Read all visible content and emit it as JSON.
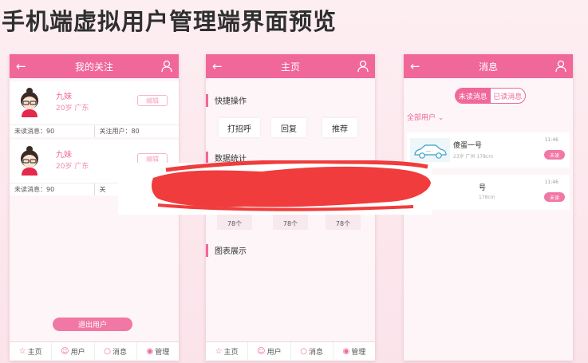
{
  "page": {
    "title": "手机端虚拟用户管理端界面预览"
  },
  "phone1": {
    "header_title": "我的关注",
    "cards": [
      {
        "name": "九妹",
        "meta": "20岁 广东",
        "button": "编辑",
        "unread": "未读消息：90",
        "followers": "关注用户：80"
      },
      {
        "name": "九妹",
        "meta": "20岁 广东",
        "button": "编辑",
        "unread": "未读消息：90",
        "followers": "关"
      }
    ],
    "exit_button": "退出用户"
  },
  "phone2": {
    "header_title": "主页",
    "quick_title": "快捷操作",
    "quick_buttons": [
      "打招呼",
      "回复",
      "推荐"
    ],
    "stats_title": "数据统计",
    "stats": [
      "78个",
      "78个",
      "78个"
    ],
    "chart_title": "图表展示"
  },
  "phone3": {
    "header_title": "消息",
    "seg_unread": "未读消息",
    "seg_read": "已读消息",
    "filter": "全部用户",
    "messages": [
      {
        "name": "傻蛋一号",
        "sub": "23岁 广州 178cm",
        "time": "11:46",
        "badge": "未读"
      },
      {
        "name": "号",
        "sub": "178cm",
        "time": "11:46",
        "badge": "未读"
      }
    ]
  },
  "tabbar": {
    "home": "主页",
    "user": "用户",
    "msg": "消息",
    "manage": "管理"
  },
  "colors": {
    "brand": "#f0679a",
    "redaction": "#f03c3c"
  }
}
